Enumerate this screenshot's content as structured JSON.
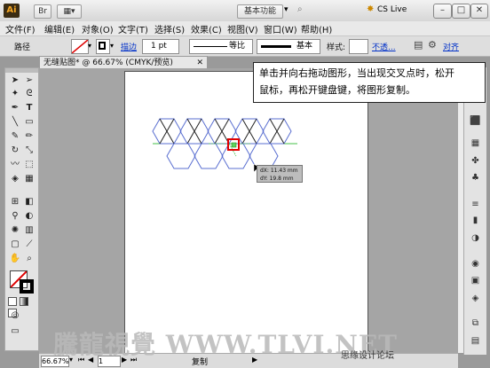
{
  "app": {
    "logo": "Ai",
    "bridge": "Br",
    "workspace": "基本功能",
    "cs_live": "CS Live"
  },
  "window_buttons": [
    "–",
    "□",
    "✕"
  ],
  "menu": [
    "文件(F)",
    "编辑(E)",
    "对象(O)",
    "文字(T)",
    "选择(S)",
    "效果(C)",
    "视图(V)",
    "窗口(W)",
    "帮助(H)"
  ],
  "control": {
    "label_path": "路径",
    "stroke_label": "描边",
    "stroke_weight": "1 pt",
    "profile": "等比",
    "brush": "基本",
    "style_label": "样式:",
    "opacity_link": "不透...",
    "align_link": "对齐"
  },
  "document": {
    "tab_title": "无缝贴图* @ 66.67% (CMYK/预览)",
    "close": "✕"
  },
  "callout": {
    "line1": "单击并向右拖动图形，当出现交叉点时，松开",
    "line2": "鼠标，再松开键盘键，将图形复制。"
  },
  "tooltip": {
    "dx": "dX: 11.43 mm",
    "dy": "dY: 19.8 mm"
  },
  "status": {
    "zoom": "66.67%",
    "page": "1",
    "tool": "复制"
  },
  "watermark": {
    "text": "騰龍視覺 WWW.TLVI.NET",
    "credit": "思缘设计论坛"
  },
  "colors": {
    "hex_blue": "#5a6fd1",
    "hex_black": "#222222",
    "guide_green": "#46c04a",
    "selection_red": "#e00000"
  }
}
